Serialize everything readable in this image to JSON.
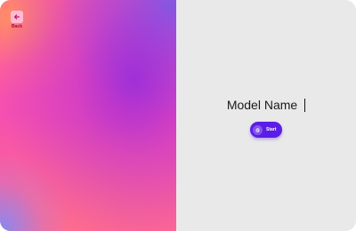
{
  "navigation": {
    "back_label": "Back",
    "back_icon": "arrow-left-icon"
  },
  "main": {
    "model_name": "Model Name",
    "start_label": "Start",
    "start_icon": "fingerprint-icon"
  },
  "colors": {
    "accent": "#5b1ee6",
    "back_label": "#b4004e",
    "right_panel_bg": "#e9e9e9"
  }
}
